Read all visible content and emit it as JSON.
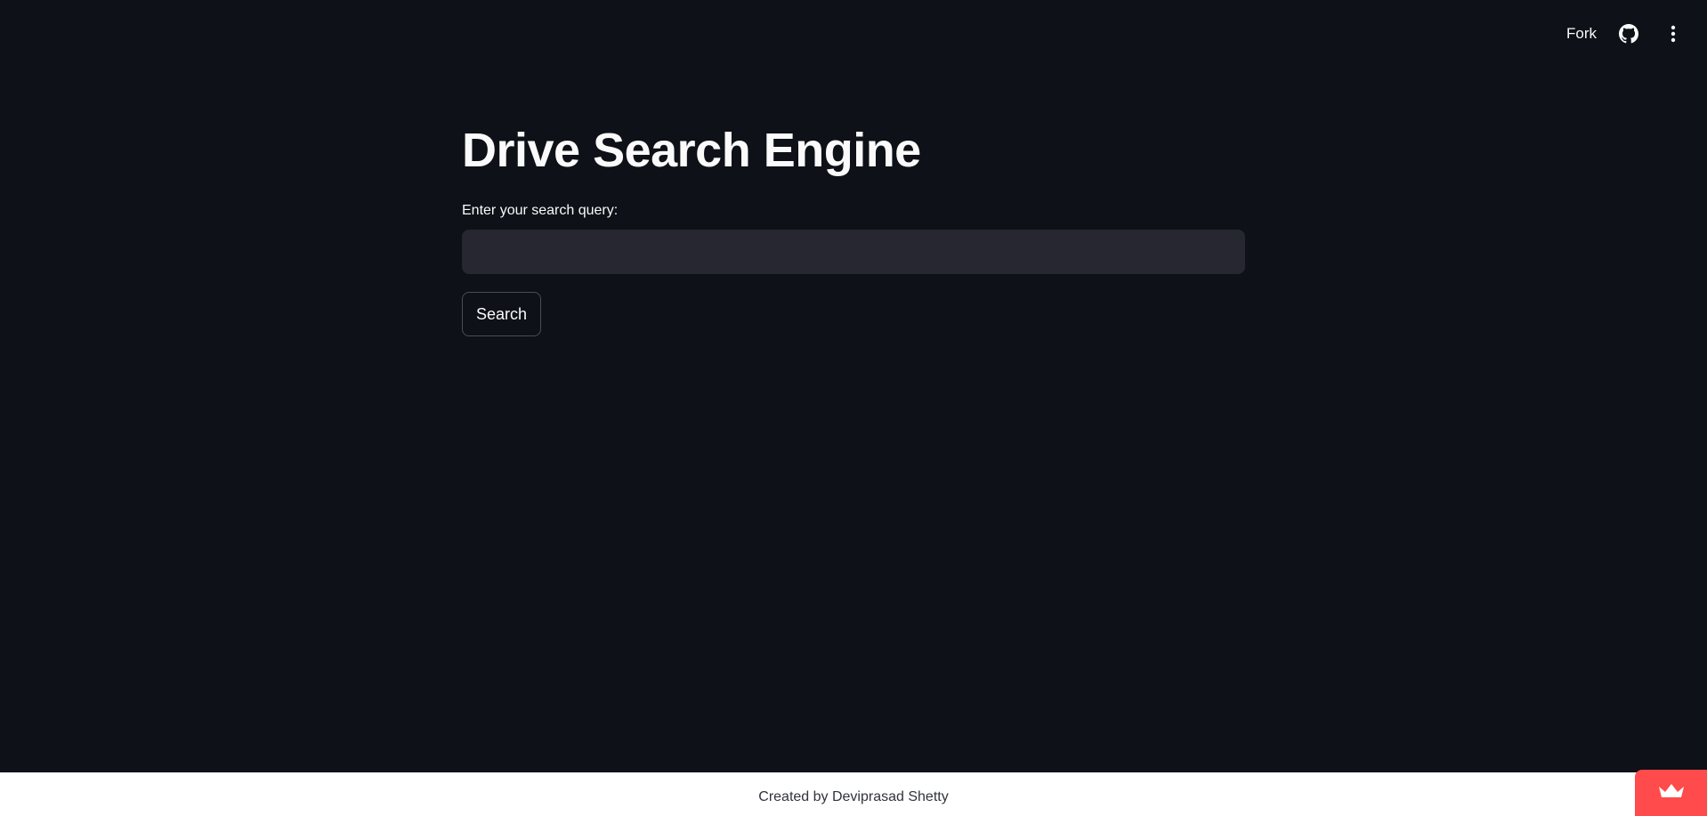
{
  "header": {
    "fork_label": "Fork",
    "github_icon": "github-icon",
    "menu_icon": "vertical-dots-icon"
  },
  "main": {
    "title": "Drive Search Engine",
    "search": {
      "label": "Enter your search query:",
      "value": "",
      "placeholder": ""
    },
    "search_button_label": "Search"
  },
  "footer": {
    "text": "Created by Deviprasad Shetty"
  },
  "badge": {
    "icon": "crown-icon",
    "color": "#ff4b4b"
  },
  "colors": {
    "background": "#0e1117",
    "input_background": "#262730",
    "text": "#fafafa",
    "footer_background": "#ffffff",
    "footer_text": "#31333f"
  }
}
